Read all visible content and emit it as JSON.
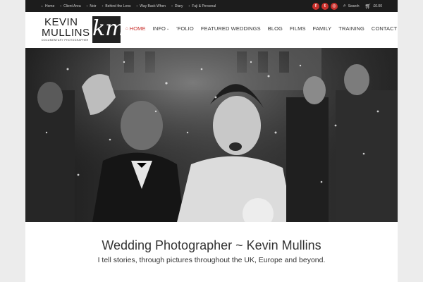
{
  "topbar": {
    "links": [
      {
        "label": "Home",
        "icon": "home-icon",
        "glyph": "⌂"
      },
      {
        "label": "Client Area",
        "icon": "user-icon",
        "glyph": "▪"
      },
      {
        "label": "Noir",
        "icon": "camera-icon",
        "glyph": "▪"
      },
      {
        "label": "Behind the Lens",
        "icon": "camera-icon",
        "glyph": "▪"
      },
      {
        "label": "Way Back When",
        "icon": "clock-icon",
        "glyph": "▪"
      },
      {
        "label": "Diary",
        "icon": "book-icon",
        "glyph": "▪"
      },
      {
        "label": "Fuji & Personal",
        "icon": "camera-icon",
        "glyph": "▪"
      }
    ],
    "social": [
      {
        "icon": "facebook-icon",
        "glyph": "f"
      },
      {
        "icon": "twitter-icon",
        "glyph": "t"
      },
      {
        "icon": "instagram-icon",
        "glyph": "◎"
      }
    ],
    "search_label": "Search",
    "cart_label": "£0.00"
  },
  "logo": {
    "line1": "KEVIN",
    "line2": "MULLINS",
    "tagline": "DOCUMENTARY PHOTOGRAPHER",
    "monogram": "km"
  },
  "nav": {
    "items": [
      {
        "label": "HOME",
        "active": true
      },
      {
        "label": "INFO",
        "dropdown": true
      },
      {
        "label": "'FOLIO"
      },
      {
        "label": "FEATURED WEDDINGS"
      },
      {
        "label": "BLOG"
      },
      {
        "label": "FILMS"
      },
      {
        "label": "FAMILY"
      },
      {
        "label": "TRAINING"
      },
      {
        "label": "CONTACT"
      }
    ]
  },
  "hero": {
    "alt": "Black and white wedding photograph of a laughing bride and groom showered with confetti"
  },
  "content": {
    "headline": "Wedding Photographer ~ Kevin Mullins",
    "subline": "I tell stories, through pictures throughout the UK, Europe and beyond."
  },
  "colors": {
    "accent": "#c9302c",
    "topbar_bg": "#1c1c1c",
    "page_bg": "#ececec"
  }
}
